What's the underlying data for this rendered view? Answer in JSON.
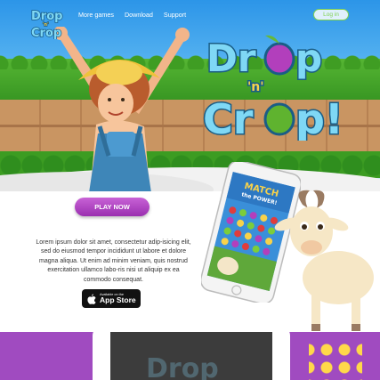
{
  "nav": {
    "items": [
      {
        "label": "More games"
      },
      {
        "label": "Download"
      },
      {
        "label": "Support"
      }
    ],
    "login_label": "Log in"
  },
  "hero": {
    "cta_label": "PLAY NOW"
  },
  "description": "Lorem ipsum dolor sit amet, consectetur adip-isicing elit, sed do eiusmod tempor incididunt ut labore et dolore magna aliqua. Ut enim ad minim veniam, quis nostrud exercitation ullamco labo-ris nisi ut aliquip ex ea commodo consequat.",
  "app_store": {
    "small": "Available on the",
    "big": "App Store"
  },
  "phone_screen": {
    "title": "MATCH",
    "subtitle": "the POWER!"
  },
  "colors": {
    "accent_purple": "#a04bc0",
    "login_green": "#7fd14f"
  }
}
